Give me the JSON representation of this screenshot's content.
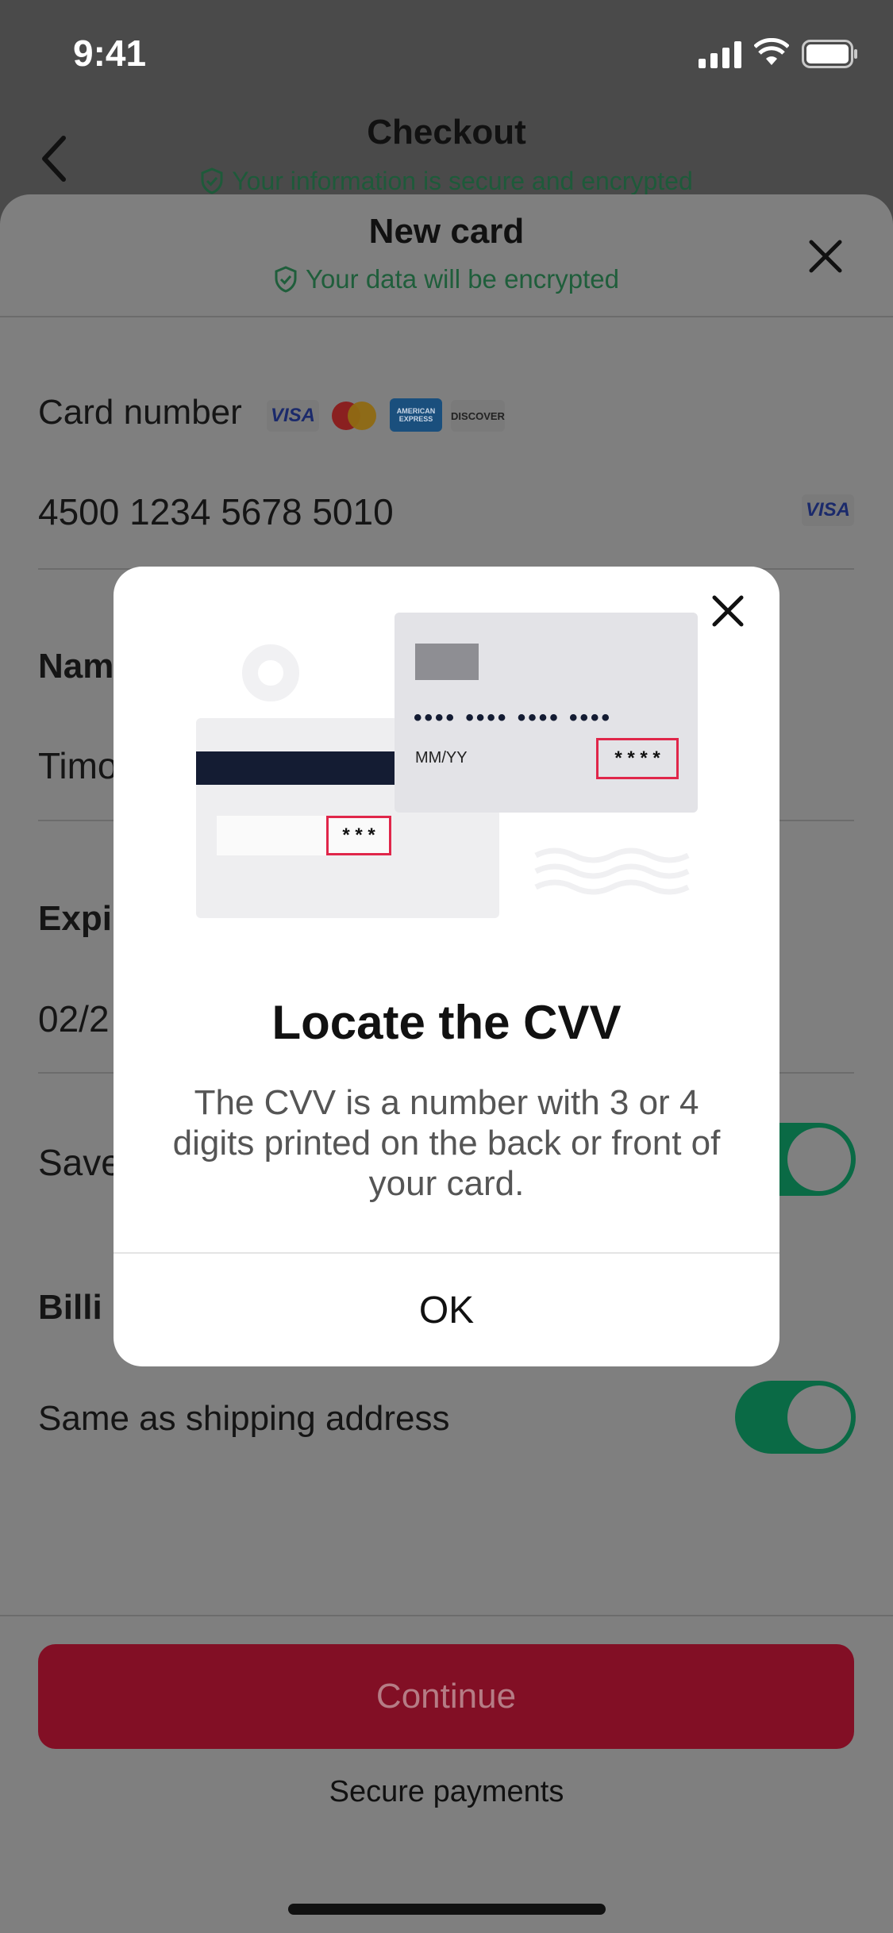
{
  "status_bar": {
    "time": "9:41"
  },
  "header": {
    "title": "Checkout",
    "subtitle": "Your information is secure and encrypted"
  },
  "sheet": {
    "title": "New card",
    "subtitle": "Your data will be encrypted",
    "card_number": {
      "label": "Card number",
      "value": "4500 1234 5678 5010",
      "brands": [
        "VISA",
        "MASTERCARD",
        "AMERICAN EXPRESS",
        "DISCOVER"
      ],
      "detected_brand": "VISA"
    },
    "name": {
      "label": "Nam",
      "value": "Timo"
    },
    "expiry": {
      "label": "Expi",
      "value": "02/2"
    },
    "save_card": {
      "label": "Save",
      "on": true
    },
    "billing": {
      "title": "Billi"
    },
    "same_as_shipping": {
      "label": "Same as shipping address",
      "on": true
    },
    "continue_label": "Continue",
    "secure_payments": "Secure payments"
  },
  "modal": {
    "title": "Locate the CVV",
    "body": "The CVV is a number with 3 or 4 digits printed on the back or front of your card.",
    "ok_label": "OK",
    "illustration": {
      "back_cvv": "* * *",
      "front_number_dots": "•••• •••• •••• ••••",
      "front_expiry": "MM/YY",
      "front_cvv": "* * * *"
    }
  },
  "colors": {
    "accent_green": "#0a6a45",
    "primary_red": "#820f25",
    "overlay": "#7f7f7f"
  }
}
